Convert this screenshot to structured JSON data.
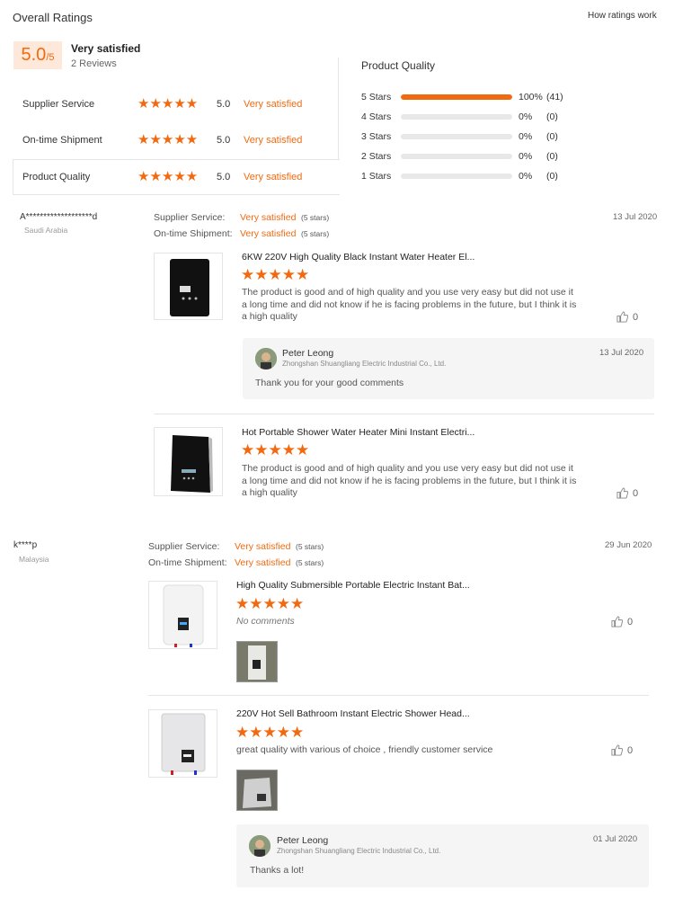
{
  "overall": {
    "title": "Overall Ratings",
    "how_link": "How ratings work",
    "score": "5.0",
    "score_out_of": "/5",
    "score_label": "Very satisfied",
    "reviews_count": "2 Reviews",
    "categories": [
      {
        "label": "Supplier Service",
        "stars": 5,
        "value": "5.0",
        "text": "Very satisfied"
      },
      {
        "label": "On-time Shipment",
        "stars": 5,
        "value": "5.0",
        "text": "Very satisfied"
      },
      {
        "label": "Product Quality",
        "stars": 5,
        "value": "5.0",
        "text": "Very satisfied"
      }
    ],
    "selected_category": "Product Quality",
    "breakdown_title": "Product Quality",
    "breakdown": [
      {
        "label": "5 Stars",
        "fraction": 1.0,
        "percent": "100%",
        "count": "(41)"
      },
      {
        "label": "4 Stars",
        "fraction": 0,
        "percent": "0%",
        "count": "(0)"
      },
      {
        "label": "3 Stars",
        "fraction": 0,
        "percent": "0%",
        "count": "(0)"
      },
      {
        "label": "2 Stars",
        "fraction": 0,
        "percent": "0%",
        "count": "(0)"
      },
      {
        "label": "1 Stars",
        "fraction": 0,
        "percent": "0%",
        "count": "(0)"
      }
    ]
  },
  "reviews": [
    {
      "user": "A*******************d",
      "country": "Saudi Arabia",
      "date": "13 Jul 2020",
      "supplier_service_label": "Supplier Service:",
      "supplier_service_value": "Very satisfied",
      "supplier_service_stars": "(5 stars)",
      "shipment_label": "On-time Shipment:",
      "shipment_value": "Very satisfied",
      "shipment_stars": "(5 stars)",
      "items": [
        {
          "product": "6KW 220V High Quality Black Instant Water Heater El...",
          "stars": 5,
          "comment": "The product is good and of high quality and you use very easy but did not use it a long time and did not know if he is facing problems in the future, but I think it is a high quality",
          "likes": "0",
          "reply": {
            "name": "Peter Leong",
            "company": "Zhongshan Shuangliang Electric Industrial Co., Ltd.",
            "date": "13 Jul 2020",
            "text": "Thank you for your good comments"
          }
        },
        {
          "product": "Hot Portable Shower Water Heater Mini Instant Electri...",
          "stars": 5,
          "comment": "The product is good and of high quality and you use very easy but did not use it a long time and did not know if he is facing problems in the future, but I think it is a high quality",
          "likes": "0"
        }
      ]
    },
    {
      "user": "k****p",
      "country": "Malaysia",
      "date": "29 Jun 2020",
      "supplier_service_label": "Supplier Service:",
      "supplier_service_value": "Very satisfied",
      "supplier_service_stars": "(5 stars)",
      "shipment_label": "On-time Shipment:",
      "shipment_value": "Very satisfied",
      "shipment_stars": "(5 stars)",
      "items": [
        {
          "product": "High Quality Submersible Portable Electric Instant Bat...",
          "stars": 5,
          "comment": "No comments",
          "likes": "0"
        },
        {
          "product": "220V Hot Sell Bathroom Instant Electric Shower Head...",
          "stars": 5,
          "comment": "great quality with various of choice , friendly customer service",
          "likes": "0",
          "reply": {
            "name": "Peter Leong",
            "company": "Zhongshan Shuangliang Electric Industrial Co., Ltd.",
            "date": "01 Jul 2020",
            "text": "Thanks a lot!"
          }
        }
      ]
    }
  ],
  "colors": {
    "accent": "#f26a10",
    "badge_bg": "#fde8d9",
    "reply_bg": "#f5f5f5",
    "border": "#e5e5e5"
  }
}
